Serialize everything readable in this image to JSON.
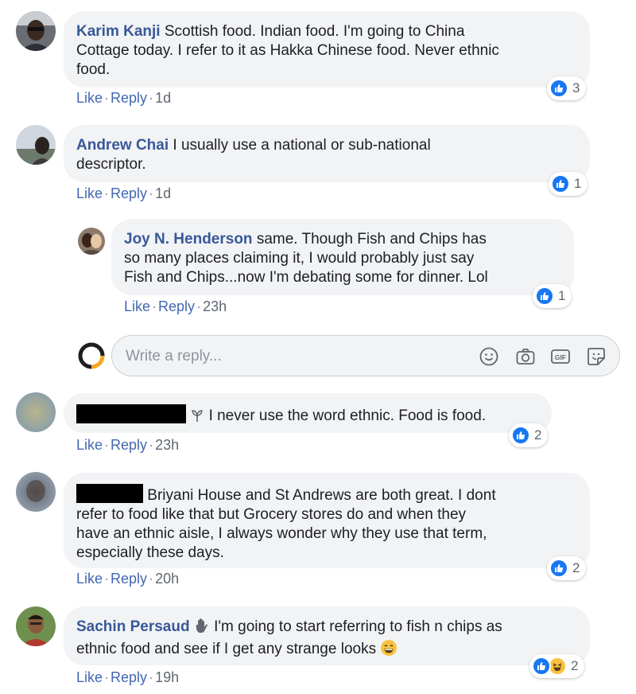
{
  "comments": [
    {
      "author": "Karim Kanji",
      "text": "Scottish food. Indian food. I'm going to China",
      "text2": "Cottage today. I refer to it as Hakka Chinese food. Never ethnic",
      "text3": "food.",
      "like": "Like",
      "reply": "Reply",
      "time": "1d",
      "reactions": "3"
    },
    {
      "author": "Andrew Chai",
      "text": "I usually use a national or sub-national",
      "text2": "descriptor.",
      "like": "Like",
      "reply": "Reply",
      "time": "1d",
      "reactions": "1"
    },
    {
      "author": "",
      "text": "I never use the word ethnic. Food is food.",
      "like": "Like",
      "reply": "Reply",
      "time": "23h",
      "reactions": "2"
    },
    {
      "author": "",
      "text": "Briyani House and St Andrews are both great. I dont",
      "text2": "refer to food like that but Grocery stores do and when they",
      "text3": "have an ethnic aisle, I always wonder why they use that term,",
      "text4": "especially these days.",
      "like": "Like",
      "reply": "Reply",
      "time": "20h",
      "reactions": "2"
    },
    {
      "author": "Sachin Persaud",
      "text": "I'm going to start referring to fish n chips as",
      "text2": "ethnic food and see if I get any strange looks",
      "like": "Like",
      "reply": "Reply",
      "time": "19h",
      "reactions": "2"
    }
  ],
  "reply": {
    "author": "Joy N. Henderson",
    "text": "same. Though Fish and Chips has",
    "text2": "so many places claiming it, I would probably just say",
    "text3": "Fish and Chips...now I'm debating some for dinner. Lol",
    "like": "Like",
    "reply": "Reply",
    "time": "23h",
    "reactions": "1"
  },
  "reply_box": {
    "placeholder": "Write a reply...",
    "icons": [
      "emoji-icon",
      "camera-icon",
      "gif-icon",
      "sticker-icon"
    ]
  },
  "colors": {
    "author": "#385898",
    "link": "#4267b2",
    "bubble": "#f2f3f5",
    "like": "#1877f2"
  }
}
